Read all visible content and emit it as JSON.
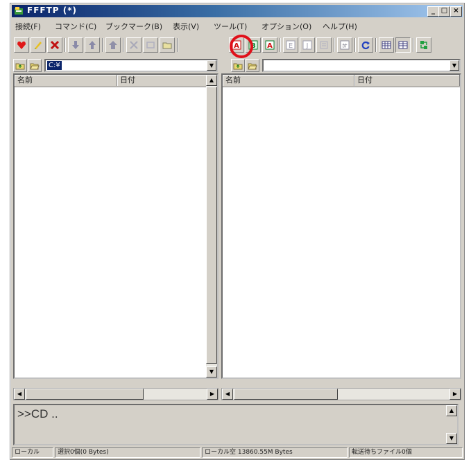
{
  "window": {
    "title": "FFFTP (*)",
    "minimize": "_",
    "maximize": "□",
    "close": "×"
  },
  "menu": [
    "接続(F)",
    "コマンド(C)",
    "ブックマーク(B)",
    "表示(V)",
    "ツール(T)",
    "オプション(O)",
    "ヘルプ(H)"
  ],
  "toolbar": {
    "buttons": [
      "connect-icon",
      "quick-connect-icon",
      "disconnect-icon",
      "download-icon",
      "upload-icon",
      "mirror-upload-icon",
      "delete-icon",
      "rename-icon",
      "mkdir-icon",
      "ascii-mode-icon",
      "binary-mode-icon",
      "auto-mode-icon",
      "kanji-euc-icon",
      "kanji-jis-icon",
      "no-conversion-icon",
      "kana-icon",
      "refresh-icon",
      "list-view-icon",
      "detail-view-icon",
      "sync-icon"
    ],
    "highlighted": "binary-mode-icon",
    "ascii_label": "A",
    "binary_label": "B",
    "auto_label": "A",
    "euc_label": "E",
    "jis_label": "J",
    "kana_label": "ｶﾅ"
  },
  "local": {
    "path": "C:¥",
    "columns": [
      "名前",
      "日付"
    ]
  },
  "remote": {
    "path": "",
    "columns": [
      "名前",
      "日付"
    ]
  },
  "log": {
    "text": ">>CD .."
  },
  "status": {
    "local": "ローカル",
    "selected": "選択0個(0 Bytes)",
    "free": "ローカル空 13860.55M Bytes",
    "queue": "転送待ちファイル0個"
  },
  "colors": {
    "title_start": "#0a246a",
    "title_end": "#a6caf0",
    "highlight_circle": "#e0101a",
    "face": "#d4d0c8"
  }
}
